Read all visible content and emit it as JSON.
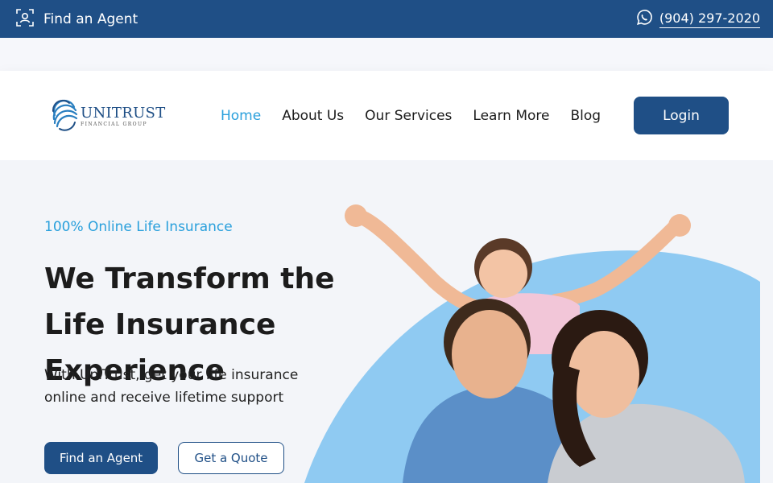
{
  "topbar": {
    "find_agent_label": "Find an Agent",
    "phone": "(904) 297-2020",
    "find_agent_icon": "person-scan-icon",
    "phone_icon": "whatsapp-icon"
  },
  "logo": {
    "name": "UniTrust",
    "name_display": "UNITRUST",
    "sub": "FINANCIAL GROUP"
  },
  "nav": {
    "items": [
      {
        "label": "Home",
        "active": true
      },
      {
        "label": "About Us",
        "active": false
      },
      {
        "label": "Our Services",
        "active": false
      },
      {
        "label": "Learn More",
        "active": false
      },
      {
        "label": "Blog",
        "active": false
      }
    ],
    "login_label": "Login"
  },
  "hero": {
    "eyebrow": "100% Online Life Insurance",
    "headline": "We Transform the Life Insurance Experience",
    "subtext": "With UniTrust, get your life insurance online and receive lifetime support",
    "primary_button": "Find an Agent",
    "secondary_button": "Get a Quote"
  },
  "colors": {
    "brand": "#1f4f86",
    "accent": "#2aa0dc",
    "blob": "#8fcaf2"
  }
}
